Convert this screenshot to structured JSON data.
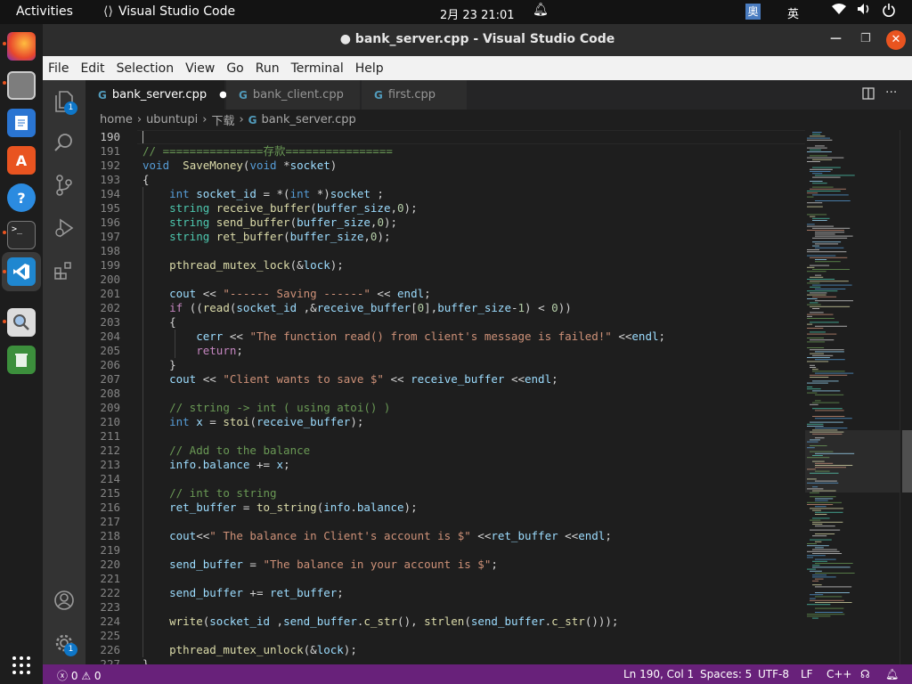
{
  "topbar": {
    "activities": "Activities",
    "app_name": "Visual Studio Code",
    "clock": "2月 23  21:01",
    "ime_1": "奧",
    "ime_2": "英"
  },
  "window": {
    "title": "● bank_server.cpp - Visual Studio Code"
  },
  "menu": [
    "File",
    "Edit",
    "Selection",
    "View",
    "Go",
    "Run",
    "Terminal",
    "Help"
  ],
  "tabs": [
    {
      "label": "bank_server.cpp",
      "active": true,
      "modified": true
    },
    {
      "label": "bank_client.cpp",
      "active": false
    },
    {
      "label": "first.cpp",
      "active": false
    }
  ],
  "breadcrumb": [
    "home",
    "ubuntupi",
    "下载",
    "bank_server.cpp"
  ],
  "badges": {
    "explorer": "1",
    "settings": "1"
  },
  "editor": {
    "current_line": 190,
    "lines": [
      {
        "n": 190,
        "t": []
      },
      {
        "n": 191,
        "t": [
          [
            "cm",
            "// ===============存款================"
          ]
        ]
      },
      {
        "n": 192,
        "t": [
          [
            "kw",
            "void"
          ],
          [
            "",
            "  "
          ],
          [
            "fn",
            "SaveMoney"
          ],
          [
            "",
            "("
          ],
          [
            "kw",
            "void"
          ],
          [
            "",
            " *"
          ],
          [
            "vr",
            "socket"
          ],
          [
            "",
            ")"
          ]
        ]
      },
      {
        "n": 193,
        "t": [
          [
            "",
            "{"
          ]
        ]
      },
      {
        "n": 194,
        "t": [
          [
            "",
            "    "
          ],
          [
            "kw",
            "int"
          ],
          [
            "",
            " "
          ],
          [
            "vr",
            "socket_id"
          ],
          [
            "",
            " = *("
          ],
          [
            "kw",
            "int"
          ],
          [
            "",
            " *)"
          ],
          [
            "vr",
            "socket"
          ],
          [
            "",
            " ;"
          ]
        ]
      },
      {
        "n": 195,
        "t": [
          [
            "",
            "    "
          ],
          [
            "ty",
            "string"
          ],
          [
            "",
            " "
          ],
          [
            "fn",
            "receive_buffer"
          ],
          [
            "",
            "("
          ],
          [
            "vr",
            "buffer_size"
          ],
          [
            "",
            ","
          ],
          [
            "num",
            "0"
          ],
          [
            "",
            ");"
          ]
        ]
      },
      {
        "n": 196,
        "t": [
          [
            "",
            "    "
          ],
          [
            "ty",
            "string"
          ],
          [
            "",
            " "
          ],
          [
            "fn",
            "send_buffer"
          ],
          [
            "",
            "("
          ],
          [
            "vr",
            "buffer_size"
          ],
          [
            "",
            ","
          ],
          [
            "num",
            "0"
          ],
          [
            "",
            ");"
          ]
        ]
      },
      {
        "n": 197,
        "t": [
          [
            "",
            "    "
          ],
          [
            "ty",
            "string"
          ],
          [
            "",
            " "
          ],
          [
            "fn",
            "ret_buffer"
          ],
          [
            "",
            "("
          ],
          [
            "vr",
            "buffer_size"
          ],
          [
            "",
            ","
          ],
          [
            "num",
            "0"
          ],
          [
            "",
            ");"
          ]
        ]
      },
      {
        "n": 198,
        "t": []
      },
      {
        "n": 199,
        "t": [
          [
            "",
            "    "
          ],
          [
            "fn",
            "pthread_mutex_lock"
          ],
          [
            "",
            "(&"
          ],
          [
            "vr",
            "lock"
          ],
          [
            "",
            ");"
          ]
        ]
      },
      {
        "n": 200,
        "t": []
      },
      {
        "n": 201,
        "t": [
          [
            "",
            "    "
          ],
          [
            "vr",
            "cout"
          ],
          [
            "",
            " << "
          ],
          [
            "str",
            "\"------ Saving ------\""
          ],
          [
            "",
            " << "
          ],
          [
            "vr",
            "endl"
          ],
          [
            "",
            ";"
          ]
        ]
      },
      {
        "n": 202,
        "t": [
          [
            "",
            "    "
          ],
          [
            "ctl",
            "if"
          ],
          [
            "",
            " (("
          ],
          [
            "fn",
            "read"
          ],
          [
            "",
            "("
          ],
          [
            "vr",
            "socket_id"
          ],
          [
            "",
            " ,&"
          ],
          [
            "vr",
            "receive_buffer"
          ],
          [
            "",
            "["
          ],
          [
            "num",
            "0"
          ],
          [
            "",
            "],"
          ],
          [
            "vr",
            "buffer_size"
          ],
          [
            "",
            "-"
          ],
          [
            "num",
            "1"
          ],
          [
            "",
            ") < "
          ],
          [
            "num",
            "0"
          ],
          [
            "",
            "))"
          ]
        ]
      },
      {
        "n": 203,
        "t": [
          [
            "",
            "    {"
          ]
        ]
      },
      {
        "n": 204,
        "t": [
          [
            "",
            "        "
          ],
          [
            "vr",
            "cerr"
          ],
          [
            "",
            " << "
          ],
          [
            "str",
            "\"The function read() from client's message is failed!\""
          ],
          [
            "",
            " <<"
          ],
          [
            "vr",
            "endl"
          ],
          [
            "",
            ";"
          ]
        ]
      },
      {
        "n": 205,
        "t": [
          [
            "",
            "        "
          ],
          [
            "ctl",
            "return"
          ],
          [
            "",
            ";"
          ]
        ]
      },
      {
        "n": 206,
        "t": [
          [
            "",
            "    }"
          ]
        ]
      },
      {
        "n": 207,
        "t": [
          [
            "",
            "    "
          ],
          [
            "vr",
            "cout"
          ],
          [
            "",
            " << "
          ],
          [
            "str",
            "\"Client wants to save $\""
          ],
          [
            "",
            " << "
          ],
          [
            "vr",
            "receive_buffer"
          ],
          [
            "",
            " <<"
          ],
          [
            "vr",
            "endl"
          ],
          [
            "",
            ";"
          ]
        ]
      },
      {
        "n": 208,
        "t": []
      },
      {
        "n": 209,
        "t": [
          [
            "",
            "    "
          ],
          [
            "cm",
            "// string -> int ( using atoi() )"
          ]
        ]
      },
      {
        "n": 210,
        "t": [
          [
            "",
            "    "
          ],
          [
            "kw",
            "int"
          ],
          [
            "",
            " "
          ],
          [
            "vr",
            "x"
          ],
          [
            "",
            " = "
          ],
          [
            "fn",
            "stoi"
          ],
          [
            "",
            "("
          ],
          [
            "vr",
            "receive_buffer"
          ],
          [
            "",
            ");"
          ]
        ]
      },
      {
        "n": 211,
        "t": []
      },
      {
        "n": 212,
        "t": [
          [
            "",
            "    "
          ],
          [
            "cm",
            "// Add to the balance"
          ]
        ]
      },
      {
        "n": 213,
        "t": [
          [
            "",
            "    "
          ],
          [
            "vr",
            "info"
          ],
          [
            "",
            "."
          ],
          [
            "vr",
            "balance"
          ],
          [
            "",
            " += "
          ],
          [
            "vr",
            "x"
          ],
          [
            "",
            ";"
          ]
        ]
      },
      {
        "n": 214,
        "t": []
      },
      {
        "n": 215,
        "t": [
          [
            "",
            "    "
          ],
          [
            "cm",
            "// int to string"
          ]
        ]
      },
      {
        "n": 216,
        "t": [
          [
            "",
            "    "
          ],
          [
            "vr",
            "ret_buffer"
          ],
          [
            "",
            " = "
          ],
          [
            "fn",
            "to_string"
          ],
          [
            "",
            "("
          ],
          [
            "vr",
            "info"
          ],
          [
            "",
            "."
          ],
          [
            "vr",
            "balance"
          ],
          [
            "",
            ");"
          ]
        ]
      },
      {
        "n": 217,
        "t": []
      },
      {
        "n": 218,
        "t": [
          [
            "",
            "    "
          ],
          [
            "vr",
            "cout"
          ],
          [
            "",
            "<<"
          ],
          [
            "str",
            "\" The balance in Client's account is $\""
          ],
          [
            "",
            " <<"
          ],
          [
            "vr",
            "ret_buffer"
          ],
          [
            "",
            " <<"
          ],
          [
            "vr",
            "endl"
          ],
          [
            "",
            ";"
          ]
        ]
      },
      {
        "n": 219,
        "t": []
      },
      {
        "n": 220,
        "t": [
          [
            "",
            "    "
          ],
          [
            "vr",
            "send_buffer"
          ],
          [
            "",
            " = "
          ],
          [
            "str",
            "\"The balance in your account is $\""
          ],
          [
            "",
            ";"
          ]
        ]
      },
      {
        "n": 221,
        "t": []
      },
      {
        "n": 222,
        "t": [
          [
            "",
            "    "
          ],
          [
            "vr",
            "send_buffer"
          ],
          [
            "",
            " += "
          ],
          [
            "vr",
            "ret_buffer"
          ],
          [
            "",
            ";"
          ]
        ]
      },
      {
        "n": 223,
        "t": []
      },
      {
        "n": 224,
        "t": [
          [
            "",
            "    "
          ],
          [
            "fn",
            "write"
          ],
          [
            "",
            "("
          ],
          [
            "vr",
            "socket_id"
          ],
          [
            "",
            " ,"
          ],
          [
            "vr",
            "send_buffer"
          ],
          [
            "",
            "."
          ],
          [
            "fn",
            "c_str"
          ],
          [
            "",
            "(), "
          ],
          [
            "fn",
            "strlen"
          ],
          [
            "",
            "("
          ],
          [
            "vr",
            "send_buffer"
          ],
          [
            "",
            "."
          ],
          [
            "fn",
            "c_str"
          ],
          [
            "",
            "()));"
          ]
        ]
      },
      {
        "n": 225,
        "t": []
      },
      {
        "n": 226,
        "t": [
          [
            "",
            "    "
          ],
          [
            "fn",
            "pthread_mutex_unlock"
          ],
          [
            "",
            "(&"
          ],
          [
            "vr",
            "lock"
          ],
          [
            "",
            ");"
          ]
        ]
      },
      {
        "n": 227,
        "t": [
          [
            "",
            "}"
          ]
        ]
      }
    ]
  },
  "status": {
    "errors": "0",
    "warnings": "0",
    "position": "Ln 190, Col 1",
    "spaces": "Spaces: 5",
    "encoding": "UTF-8",
    "eol": "LF",
    "language": "C++"
  }
}
